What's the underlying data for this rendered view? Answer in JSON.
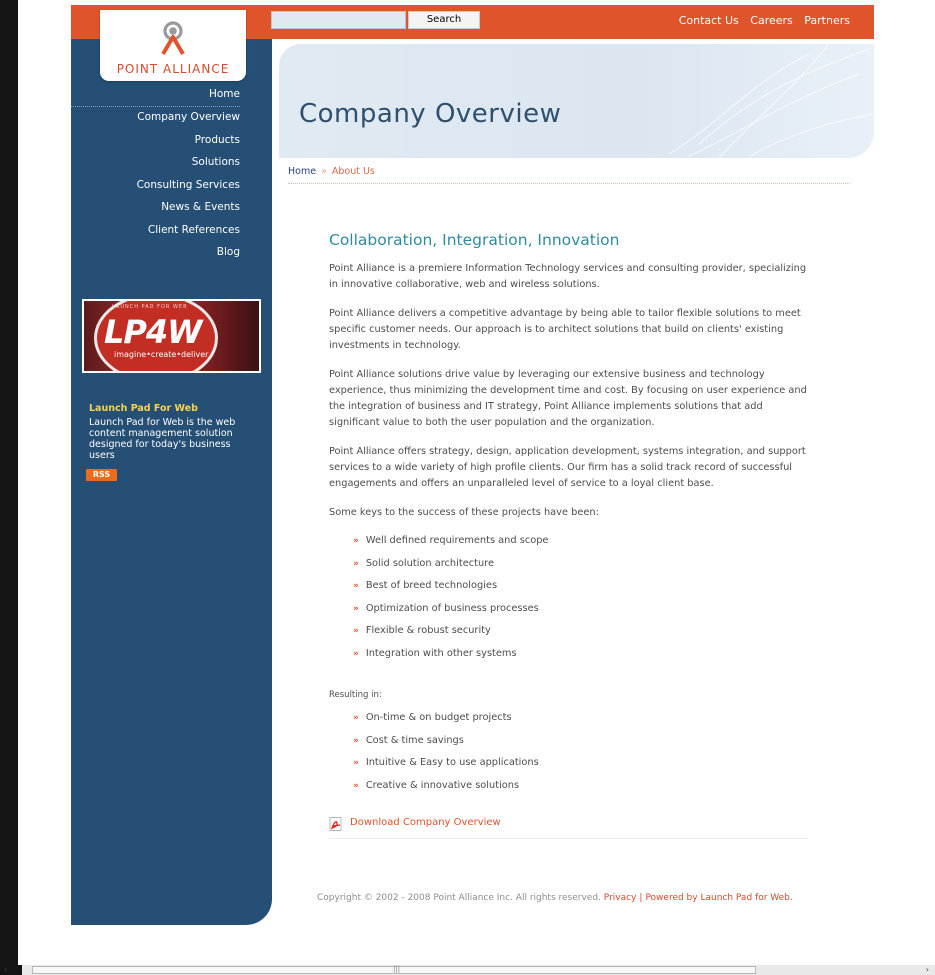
{
  "topbar": {
    "search_placeholder": "",
    "search_button": "Search",
    "links": [
      "Contact Us",
      "Careers",
      "Partners"
    ]
  },
  "logo": {
    "text": "POINT ALLIANCE",
    "icon": "point-alliance-logo-icon"
  },
  "nav": {
    "items": [
      {
        "label": "Home"
      },
      {
        "label": "Company Overview",
        "active": true
      },
      {
        "label": "Products"
      },
      {
        "label": "Solutions"
      },
      {
        "label": "Consulting Services"
      },
      {
        "label": "News & Events"
      },
      {
        "label": "Client References"
      },
      {
        "label": "Blog"
      }
    ]
  },
  "promo": {
    "banner_top": "LAUNCH PAD FOR WEB",
    "banner_logo": "LP4W",
    "banner_tagline": "imagine•create•deliver",
    "title": "Launch Pad For Web",
    "description": "Launch Pad for Web is the web content management solution designed for today's business users",
    "rss_label": "RSS"
  },
  "header": {
    "title": "Company Overview"
  },
  "breadcrumb": {
    "home": "Home",
    "separator": "»",
    "current": "About Us"
  },
  "main": {
    "headline": "Collaboration, Integration, Innovation",
    "paragraphs": [
      "Point Alliance is a premiere Information Technology services and consulting provider, specializing in innovative collaborative, web and wireless solutions.",
      "Point Alliance delivers a competitive advantage by being able to tailor flexible solutions to meet specific customer needs. Our approach is to architect solutions that build on clients' existing investments in technology.",
      "Point Alliance solutions drive value by leveraging our extensive business and technology experience, thus minimizing the development time and cost. By focusing on user experience and the integration of business and IT strategy, Point Alliance implements solutions that add significant value to both the user population and the organization.",
      "Point Alliance offers strategy, design, application development, systems integration, and support services to a wide variety of high profile clients. Our firm has a solid track record of successful engagements and offers an unparalleled level of service to a loyal client base."
    ],
    "keys_intro": "Some keys to the success of these projects have been:",
    "keys": [
      "Well defined requirements and scope",
      "Solid solution architecture",
      "Best of breed technologies",
      "Optimization of business processes",
      "Flexible & robust security",
      "Integration with other systems"
    ],
    "results_intro": "Resulting in:",
    "results": [
      "On-time & on budget projects",
      "Cost & time savings",
      "Intuitive & Easy to use applications",
      "Creative & innovative solutions"
    ],
    "bullet_glyph": "»",
    "download_label": "Download Company Overview"
  },
  "footer": {
    "copyright": "Copyright © 2002 - 2008 Point Alliance Inc. All rights reserved.",
    "privacy": "Privacy",
    "separator": "|",
    "powered": "Powered by Launch Pad for Web."
  },
  "scrollbar": {
    "grip": "|||",
    "left_arrow": "‹",
    "right_arrow": "›"
  },
  "colors": {
    "accent": "#e0542c",
    "sidebar": "#264f75",
    "headline": "#2f8c9f",
    "title": "#2f4f6d"
  }
}
